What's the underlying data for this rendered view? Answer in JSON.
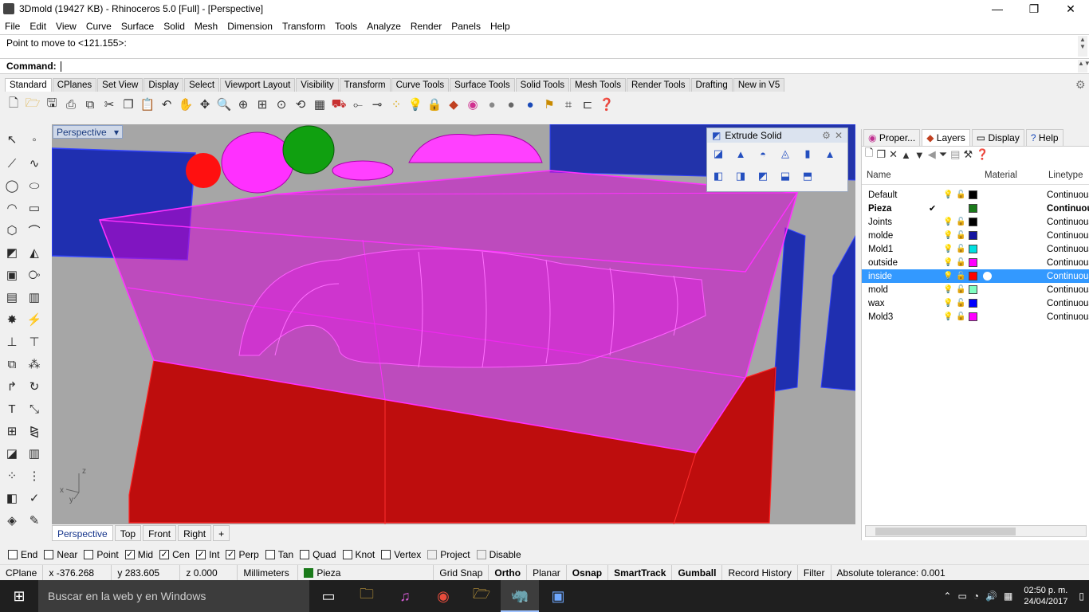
{
  "window": {
    "title": "3Dmold (19427 KB) - Rhinoceros 5.0 [Full] - [Perspective]",
    "controls": [
      "—",
      "❐",
      "✕"
    ]
  },
  "menu": [
    "File",
    "Edit",
    "View",
    "Curve",
    "Surface",
    "Solid",
    "Mesh",
    "Dimension",
    "Transform",
    "Tools",
    "Analyze",
    "Render",
    "Panels",
    "Help"
  ],
  "command": {
    "history": "Point to move to <121.155>:",
    "prompt": "Command:"
  },
  "toolbar_tabs": [
    "Standard",
    "CPlanes",
    "Set View",
    "Display",
    "Select",
    "Viewport Layout",
    "Visibility",
    "Transform",
    "Curve Tools",
    "Surface Tools",
    "Solid Tools",
    "Mesh Tools",
    "Render Tools",
    "Drafting",
    "New in V5"
  ],
  "toolbar_icons": [
    "new-file",
    "open",
    "save",
    "print",
    "import",
    "cut",
    "copy",
    "paste",
    "undo",
    "pan",
    "move",
    "zoom",
    "zoom-window",
    "zoom-extents",
    "zoom-selected",
    "rotate-view",
    "four-views",
    "car-model",
    "trim",
    "curve-tool",
    "points",
    "light",
    "lock",
    "layer",
    "color",
    "material-sphere",
    "render-sphere",
    "blue-sphere",
    "snap",
    "grid",
    "hide",
    "help"
  ],
  "viewport": {
    "name": "Perspective",
    "tabs": [
      "Perspective",
      "Top",
      "Front",
      "Right"
    ],
    "axis": {
      "x": "x",
      "y": "y",
      "z": "z"
    }
  },
  "extrude_panel": {
    "title": "Extrude Solid"
  },
  "panel": {
    "tabs": [
      "Proper...",
      "Layers",
      "Display",
      "Help"
    ],
    "headers": {
      "name": "Name",
      "material": "Material",
      "linetype": "Linetype"
    },
    "layers": [
      {
        "name": "Default",
        "color": "#000000",
        "linetype": "Continuous",
        "bulb": "blue"
      },
      {
        "name": "Pieza",
        "color": "#1a7a1a",
        "linetype": "Continuous",
        "current": true
      },
      {
        "name": "Joints",
        "color": "#000000",
        "linetype": "Continuous",
        "bulb": "blue"
      },
      {
        "name": "molde",
        "color": "#1414a0",
        "linetype": "Continuous",
        "bulb": "blue"
      },
      {
        "name": "Mold1",
        "color": "#00e0e0",
        "linetype": "Continuous",
        "bulb": "blue"
      },
      {
        "name": "outside",
        "color": "#ff00ff",
        "linetype": "Continuous",
        "bulb": "yellow"
      },
      {
        "name": "inside",
        "color": "#ff0000",
        "linetype": "Continuous",
        "bulb": "yellow",
        "selected": true
      },
      {
        "name": "mold",
        "color": "#80ffc0",
        "linetype": "Continuous",
        "bulb": "blue"
      },
      {
        "name": "wax",
        "color": "#0000ff",
        "linetype": "Continuous",
        "bulb": "yellow"
      },
      {
        "name": "Mold3",
        "color": "#ff00ff",
        "linetype": "Continuous",
        "bulb": "yellow"
      }
    ]
  },
  "osnaps": [
    {
      "label": "End",
      "checked": false
    },
    {
      "label": "Near",
      "checked": false
    },
    {
      "label": "Point",
      "checked": false
    },
    {
      "label": "Mid",
      "checked": true
    },
    {
      "label": "Cen",
      "checked": true
    },
    {
      "label": "Int",
      "checked": true
    },
    {
      "label": "Perp",
      "checked": true
    },
    {
      "label": "Tan",
      "checked": false
    },
    {
      "label": "Quad",
      "checked": false
    },
    {
      "label": "Knot",
      "checked": false
    },
    {
      "label": "Vertex",
      "checked": false
    },
    {
      "label": "Project",
      "checked": false,
      "disabled": true
    },
    {
      "label": "Disable",
      "checked": false,
      "disabled": true
    }
  ],
  "status": {
    "cplane": "CPlane",
    "x": "x -376.268",
    "y": "y 283.605",
    "z": "z 0.000",
    "units": "Millimeters",
    "layer": "Pieza",
    "layer_color": "#1a7a1a",
    "toggles": [
      {
        "label": "Grid Snap",
        "bold": false
      },
      {
        "label": "Ortho",
        "bold": true
      },
      {
        "label": "Planar",
        "bold": false
      },
      {
        "label": "Osnap",
        "bold": true
      },
      {
        "label": "SmartTrack",
        "bold": true
      },
      {
        "label": "Gumball",
        "bold": true
      },
      {
        "label": "Record History",
        "bold": false
      },
      {
        "label": "Filter",
        "bold": false
      }
    ],
    "tolerance": "Absolute tolerance: 0.001"
  },
  "taskbar": {
    "search_placeholder": "Buscar en la web y en Windows",
    "time": "02:50 p. m.",
    "date": "24/04/2017"
  },
  "colors": {
    "viewport_bg": "#a6a6a6",
    "magenta": "#ff00ff",
    "red_box": "#c00000",
    "blue_box": "#1a1aa8",
    "selection": "#3399ff"
  }
}
